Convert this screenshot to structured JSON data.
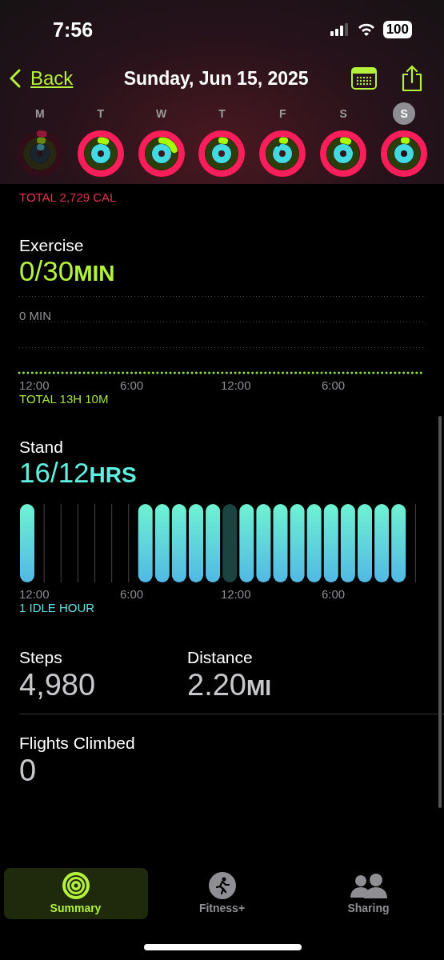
{
  "status_bar": {
    "time": "7:56",
    "battery": "100"
  },
  "nav": {
    "back": "Back",
    "title": "Sunday, Jun 15, 2025"
  },
  "week": [
    {
      "day": "M",
      "selected": false,
      "dimmed": true
    },
    {
      "day": "T",
      "selected": false,
      "dimmed": false
    },
    {
      "day": "W",
      "selected": false,
      "dimmed": false
    },
    {
      "day": "T",
      "selected": false,
      "dimmed": false
    },
    {
      "day": "F",
      "selected": false,
      "dimmed": false
    },
    {
      "day": "S",
      "selected": false,
      "dimmed": false
    },
    {
      "day": "S",
      "selected": true,
      "dimmed": false
    }
  ],
  "move_total": "TOTAL 2,729 CAL",
  "exercise": {
    "title": "Exercise",
    "value": "0/30",
    "unit": "MIN",
    "scale_label": "0 MIN",
    "ticks": [
      "12:00",
      "6:00",
      "12:00",
      "6:00"
    ],
    "total": "TOTAL 13H 10M"
  },
  "stand": {
    "title": "Stand",
    "value": "16/12",
    "unit": "HRS",
    "hours": [
      {
        "kind": "stood"
      },
      {
        "kind": "empty"
      },
      {
        "kind": "empty"
      },
      {
        "kind": "empty"
      },
      {
        "kind": "empty"
      },
      {
        "kind": "empty"
      },
      {
        "kind": "empty"
      },
      {
        "kind": "stood"
      },
      {
        "kind": "stood"
      },
      {
        "kind": "stood"
      },
      {
        "kind": "stood"
      },
      {
        "kind": "stood"
      },
      {
        "kind": "idle"
      },
      {
        "kind": "stood"
      },
      {
        "kind": "stood"
      },
      {
        "kind": "stood"
      },
      {
        "kind": "stood"
      },
      {
        "kind": "stood"
      },
      {
        "kind": "stood"
      },
      {
        "kind": "stood"
      },
      {
        "kind": "stood"
      },
      {
        "kind": "stood"
      },
      {
        "kind": "stood"
      },
      {
        "kind": "empty"
      }
    ],
    "ticks": [
      "12:00",
      "6:00",
      "12:00",
      "6:00"
    ],
    "idle": "1 IDLE HOUR"
  },
  "stats": [
    {
      "label": "Steps",
      "value": "4,980"
    },
    {
      "label": "Distance",
      "value": "2.20",
      "unit": "MI"
    }
  ],
  "flights": {
    "label": "Flights Climbed",
    "value": "0"
  },
  "tabs": [
    {
      "label": "Summary",
      "selected": true,
      "kind": "summary"
    },
    {
      "label": "Fitness+",
      "selected": false,
      "kind": "fitness"
    },
    {
      "label": "Sharing",
      "selected": false,
      "kind": "sharing"
    }
  ]
}
